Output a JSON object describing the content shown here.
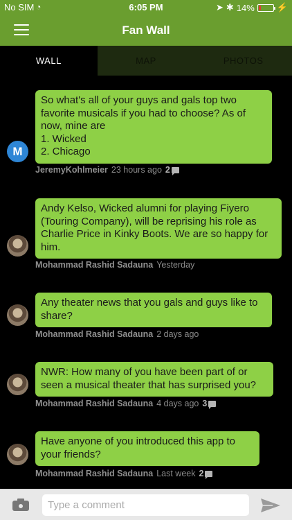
{
  "status_bar": {
    "carrier": "No SIM",
    "time": "6:05 PM",
    "battery": "14%",
    "battery_level": 0.14
  },
  "header": {
    "title": "Fan Wall"
  },
  "tabs": [
    {
      "label": "WALL",
      "active": true
    },
    {
      "label": "MAP",
      "active": false
    },
    {
      "label": "PHOTOS",
      "active": false
    }
  ],
  "posts": [
    {
      "avatar_letter": "M",
      "text": "So what's all of your guys and gals top two favorite musicals if you had to choose? As of now, mine are\n1. Wicked\n2. Chicago",
      "author": "JeremyKohlmeier",
      "time": "23 hours ago",
      "comment_count": "2"
    },
    {
      "text": "Andy Kelso, Wicked alumni for playing Fiyero (Touring Company), will be reprising his role as Charlie Price in Kinky Boots. We are so happy for him.",
      "author": "Mohammad Rashid Sadauna",
      "time": "Yesterday"
    },
    {
      "text": "Any theater news that you gals and guys like to share?",
      "author": "Mohammad Rashid Sadauna",
      "time": "2 days ago"
    },
    {
      "text": "NWR: How many of you have been part of or seen a musical theater that has surprised you?",
      "author": "Mohammad Rashid Sadauna",
      "time": "4 days ago",
      "comment_count": "3"
    },
    {
      "text": "Have anyone of you introduced this app to your friends?",
      "author": "Mohammad Rashid Sadauna",
      "time": "Last week",
      "comment_count": "2"
    }
  ],
  "composer": {
    "placeholder": "Type a comment"
  },
  "colors": {
    "brand_green": "#6a9e2f",
    "bubble_green": "#8ed046",
    "tab_inactive_bg": "#1e2a10",
    "avatar_blue": "#2e86d6",
    "battery_red": "#e03a2f"
  }
}
